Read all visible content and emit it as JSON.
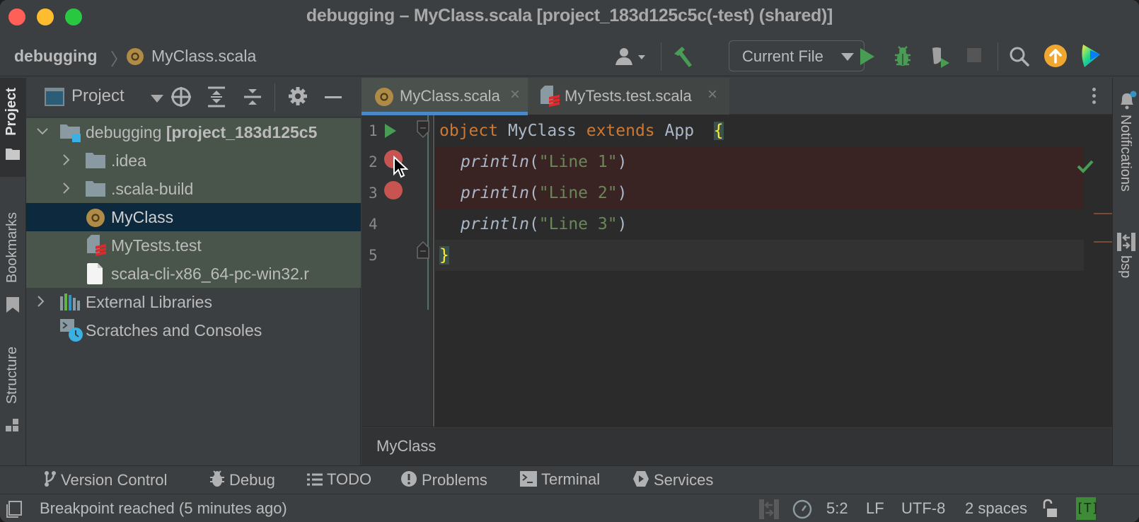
{
  "window": {
    "title": "debugging – MyClass.scala [project_183d125c5c(-test) (shared)]"
  },
  "navbar": {
    "breadcrumb": [
      {
        "label": "debugging"
      },
      {
        "label": "MyClass.scala",
        "icon": "scala-object-icon"
      }
    ],
    "run_config": {
      "selected": "Current File"
    },
    "actions": [
      "vcs-user-icon",
      "build-hammer-icon",
      "run-icon",
      "debug-bug-icon",
      "coverage-icon",
      "stop-icon",
      "search-icon",
      "update-icon",
      "jetbrains-logo-icon"
    ]
  },
  "left_stripe": {
    "items": [
      {
        "label": "Project",
        "active": true
      },
      {
        "label": "Bookmarks"
      },
      {
        "label": "Structure"
      }
    ]
  },
  "project_panel": {
    "title": "Project",
    "tree": [
      {
        "label": "debugging",
        "suffix": "[project_183d125c5",
        "icon": "module-folder-icon",
        "expanded": true,
        "level": 0
      },
      {
        "label": ".idea",
        "icon": "folder-icon",
        "expanded": false,
        "level": 1
      },
      {
        "label": ".scala-build",
        "icon": "folder-icon",
        "expanded": false,
        "level": 1
      },
      {
        "label": "MyClass",
        "icon": "scala-object-icon",
        "level": 1,
        "selected": true
      },
      {
        "label": "MyTests.test",
        "icon": "scala-test-file-icon",
        "level": 1
      },
      {
        "label": "scala-cli-x86_64-pc-win32.r",
        "icon": "file-icon",
        "level": 1
      },
      {
        "label": "External Libraries",
        "icon": "libraries-icon",
        "expanded": false,
        "level": 0
      },
      {
        "label": "Scratches and Consoles",
        "icon": "scratches-icon",
        "level": 0
      }
    ]
  },
  "editor": {
    "tabs": [
      {
        "label": "MyClass.scala",
        "active": true
      },
      {
        "label": "MyTests.test.scala",
        "active": false
      }
    ],
    "lines": [
      {
        "num": "1",
        "kw1": "object",
        "name": " MyClass ",
        "kw2": "extends",
        "rest": " App  ",
        "brace": "{"
      },
      {
        "num": "2",
        "fn": "println",
        "open": "(",
        "str": "\"Line 1\"",
        "close": ")",
        "breakpoint": true
      },
      {
        "num": "3",
        "fn": "println",
        "open": "(",
        "str": "\"Line 2\"",
        "close": ")",
        "breakpoint": true
      },
      {
        "num": "4",
        "fn": "println",
        "open": "(",
        "str": "\"Line 3\"",
        "close": ")"
      },
      {
        "num": "5",
        "brace": "}"
      }
    ],
    "breadcrumb": "MyClass",
    "inspection_status": "no-problems"
  },
  "right_stripe": {
    "items": [
      {
        "label": "Notifications"
      },
      {
        "label": "bsp"
      }
    ]
  },
  "bottom_tools": [
    {
      "label": "Version Control"
    },
    {
      "label": "Debug"
    },
    {
      "label": "TODO"
    },
    {
      "label": "Problems"
    },
    {
      "label": "Terminal"
    },
    {
      "label": "Services"
    }
  ],
  "status_bar": {
    "message": "Breakpoint reached (5 minutes ago)",
    "caret": "5:2",
    "line_sep": "LF",
    "encoding": "UTF-8",
    "indent": "2 spaces",
    "badge": "[T]"
  },
  "colors": {
    "accent": "#4a88c7",
    "breakpoint": "#c75450",
    "run": "#499c54",
    "keyword": "#cc7832",
    "string": "#6a8759",
    "update": "#f0a732"
  }
}
